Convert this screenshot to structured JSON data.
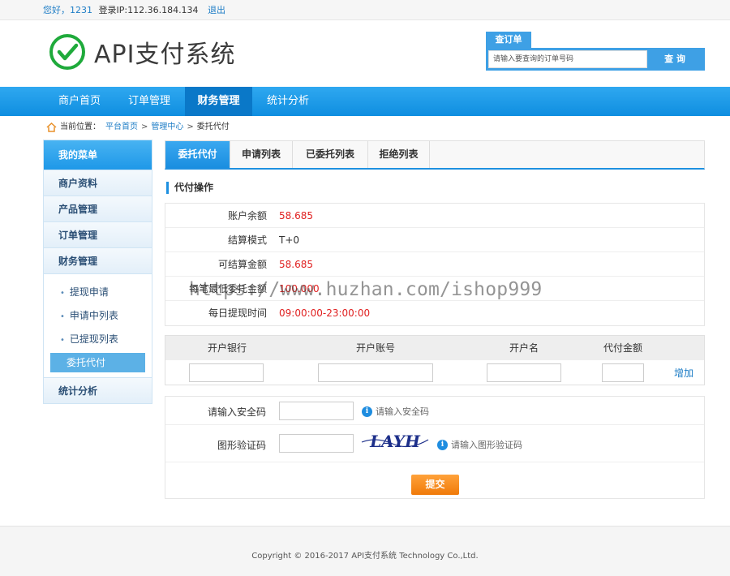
{
  "topbar": {
    "greeting": "您好，1231",
    "login_ip": "登录IP:112.36.184.134",
    "logout": "退出"
  },
  "logo": {
    "text": "API支付系统",
    "icon": "check-circle-icon",
    "color": "#1faa3b"
  },
  "order_search": {
    "tab_label": "查订单",
    "placeholder": "请输入要查询的订单号码",
    "button": "查 询"
  },
  "nav": {
    "items": [
      {
        "label": "商户首页"
      },
      {
        "label": "订单管理"
      },
      {
        "label": "财务管理",
        "active": true
      },
      {
        "label": "统计分析"
      }
    ]
  },
  "breadcrumb": {
    "prefix": "当前位置：",
    "items": [
      "平台首页",
      "管理中心",
      "委托代付"
    ],
    "separator": ">"
  },
  "sidebar": {
    "title": "我的菜单",
    "items": [
      {
        "label": "商户资料"
      },
      {
        "label": "产品管理"
      },
      {
        "label": "订单管理"
      },
      {
        "label": "财务管理"
      }
    ],
    "sub_items": [
      {
        "label": "提现申请"
      },
      {
        "label": "申请中列表"
      },
      {
        "label": "已提现列表"
      },
      {
        "label": "委托代付",
        "active": true
      }
    ],
    "last_item": {
      "label": "统计分析"
    }
  },
  "tabs": [
    {
      "label": "委托代付",
      "active": true
    },
    {
      "label": "申请列表"
    },
    {
      "label": "已委托列表"
    },
    {
      "label": "拒绝列表"
    }
  ],
  "section": {
    "title": "代付操作"
  },
  "info": {
    "rows": [
      {
        "label": "账户余额",
        "value": "58.685",
        "highlight": true
      },
      {
        "label": "结算模式",
        "value": "T+0",
        "highlight": false
      },
      {
        "label": "可结算金额",
        "value": "58.685",
        "highlight": true
      },
      {
        "label": "每笔最低委托金额",
        "value": "100.000",
        "highlight": true
      },
      {
        "label": "每日提现时间",
        "value": "09:00:00-23:00:00",
        "highlight": true
      }
    ]
  },
  "watermark": "https://www.huzhan.com/ishop999",
  "bank": {
    "headers": [
      "开户银行",
      "开户账号",
      "开户名",
      "代付金额"
    ],
    "add_label": "增加"
  },
  "form": {
    "security_code_label": "请输入安全码",
    "security_code_hint": "请输入安全码",
    "captcha_label": "图形验证码",
    "captcha_text": "LAYH",
    "captcha_hint": "请输入图形验证码",
    "submit": "提交"
  },
  "footer": {
    "copyright": "Copyright © 2016-2017 API支付系统 Technology Co.,Ltd."
  },
  "colors": {
    "primary": "#1e90e0",
    "value_red": "#e02020",
    "submit_orange": "#f48a1c"
  }
}
